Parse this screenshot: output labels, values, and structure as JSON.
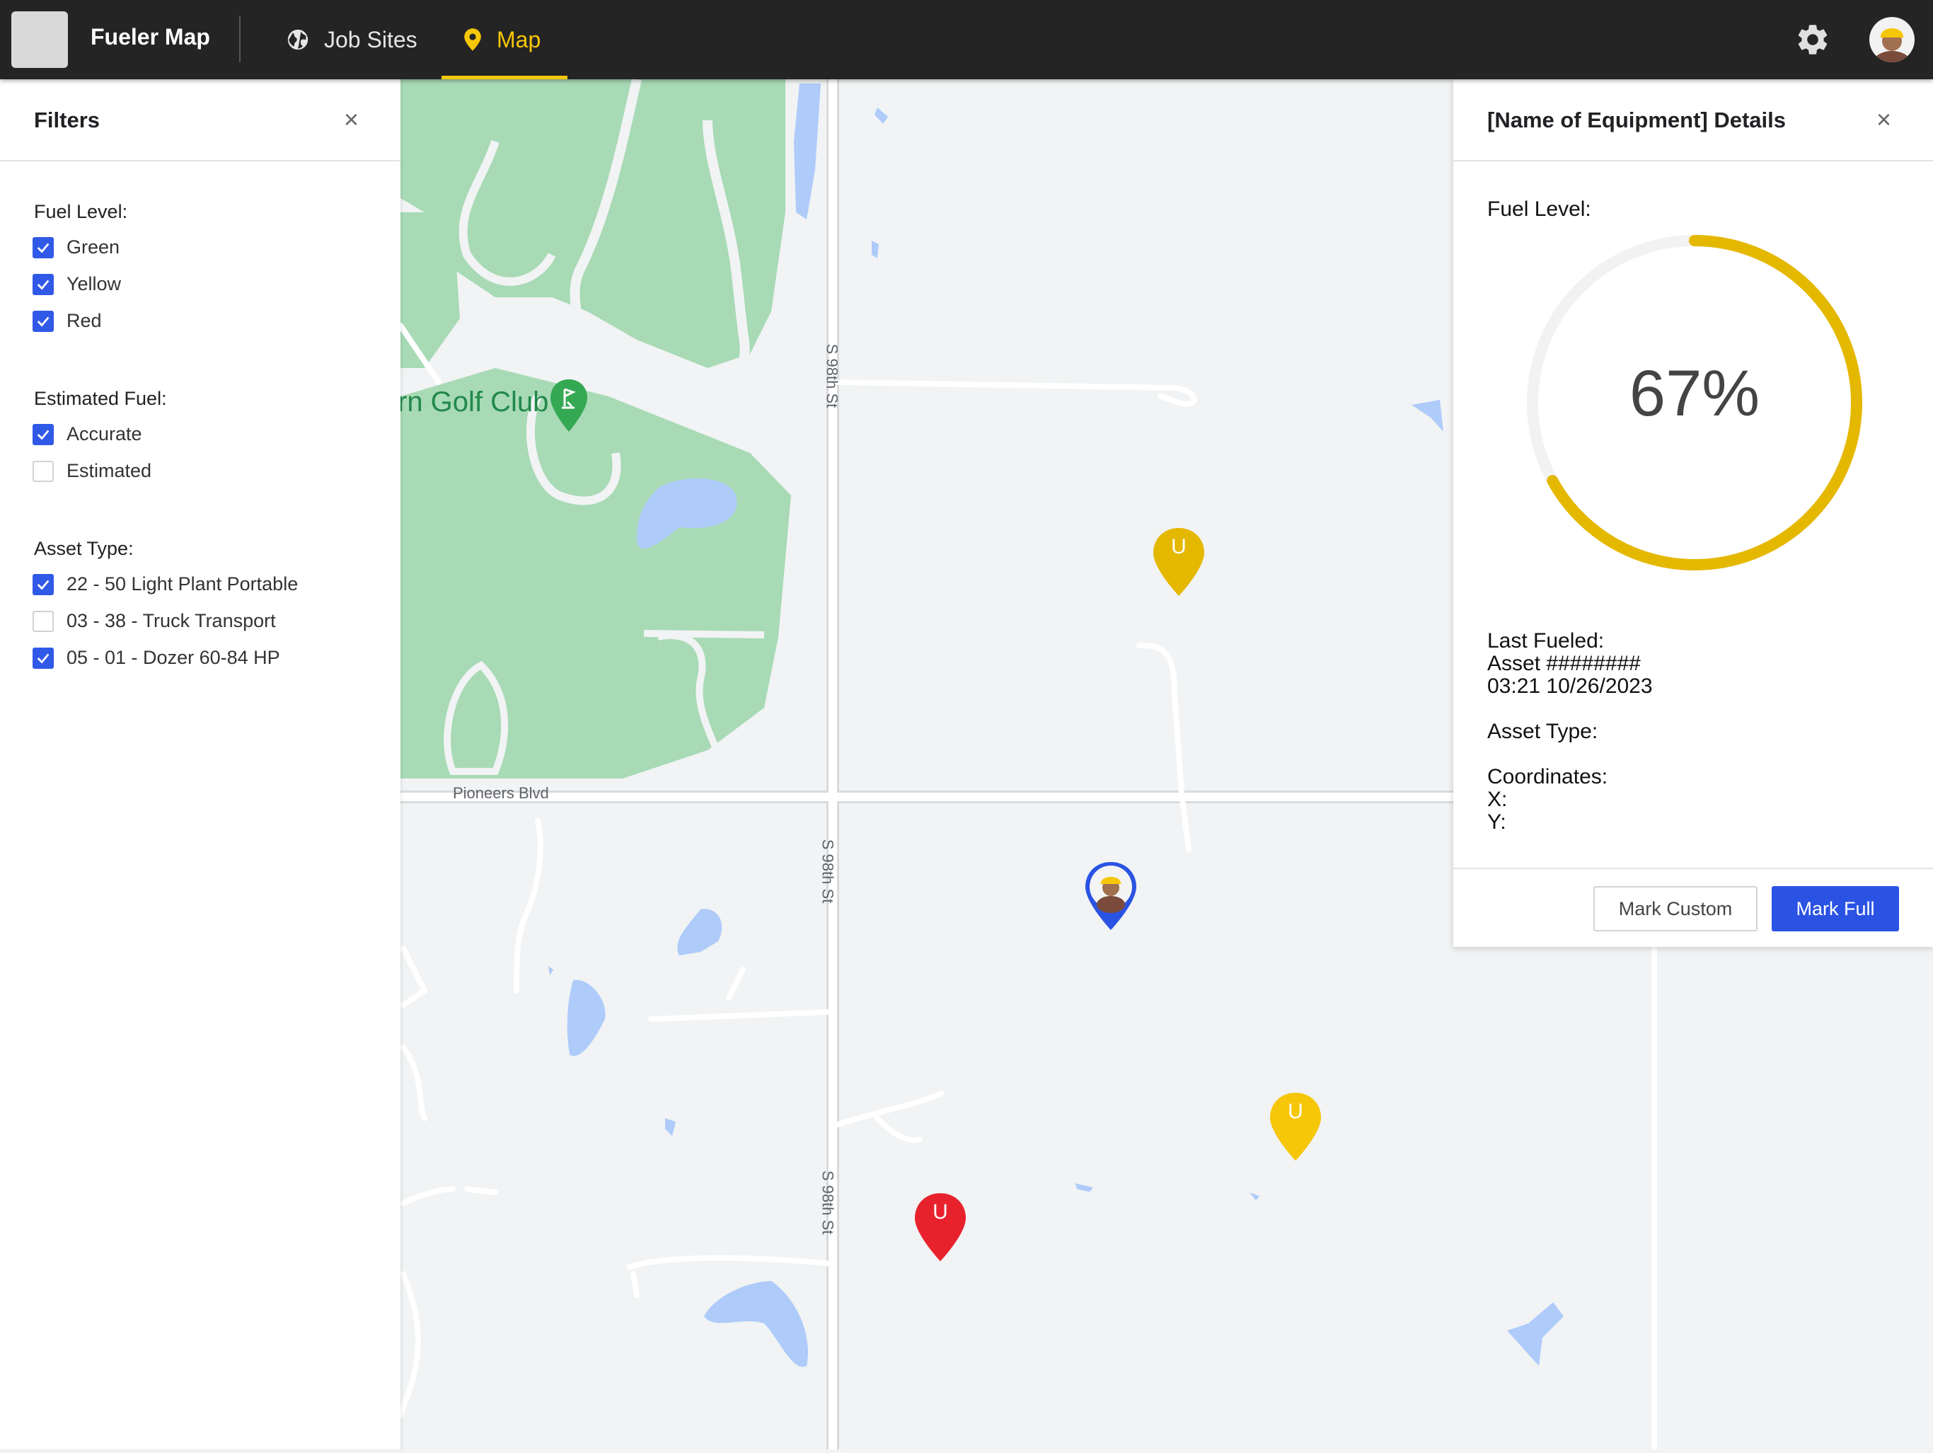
{
  "header": {
    "app_title": "Fueler Map",
    "nav": [
      {
        "label": "Job Sites",
        "icon": "globe-icon",
        "active": false
      },
      {
        "label": "Map",
        "icon": "map-pin-icon",
        "active": true
      }
    ],
    "settings_icon": "gear-icon",
    "avatar": "user-avatar"
  },
  "map": {
    "labels": {
      "golf_club": "rn Golf Club",
      "road_1": "S 98th St",
      "road_2": "S 98th St",
      "road_3": "S 98th St",
      "pioneers": "Pioneers Blvd"
    },
    "markers": [
      {
        "label": "U",
        "status": "yellow",
        "color": "#e5b800"
      },
      {
        "label": "",
        "status": "user",
        "color": "#2b53e3"
      },
      {
        "label": "U",
        "status": "yellow",
        "color": "#f6c609"
      },
      {
        "label": "U",
        "status": "red",
        "color": "#e8222d"
      }
    ]
  },
  "filters": {
    "title": "Filters",
    "groups": [
      {
        "label": "Fuel Level:",
        "options": [
          {
            "label": "Green",
            "checked": true
          },
          {
            "label": "Yellow",
            "checked": true
          },
          {
            "label": "Red",
            "checked": true
          }
        ]
      },
      {
        "label": "Estimated Fuel:",
        "options": [
          {
            "label": "Accurate",
            "checked": true
          },
          {
            "label": "Estimated",
            "checked": false
          }
        ]
      },
      {
        "label": "Asset Type:",
        "options": [
          {
            "label": "22 - 50 Light Plant Portable",
            "checked": true
          },
          {
            "label": "03 - 38 - Truck Transport",
            "checked": false
          },
          {
            "label": "05 - 01 - Dozer 60-84 HP",
            "checked": true
          }
        ]
      }
    ]
  },
  "details": {
    "title": "[Name of Equipment] Details",
    "fuel_level_label": "Fuel Level:",
    "fuel_percent": 67,
    "fuel_percent_text": "67%",
    "gauge_color": "#e5b800",
    "gauge_track_color": "#f2f2f2",
    "last_fueled_label": "Last Fueled:",
    "last_fueled_asset": "Asset ########",
    "last_fueled_time": "03:21 10/26/2023",
    "asset_type_label": "Asset Type:",
    "coordinates_label": "Coordinates:",
    "x_label": "X:",
    "y_label": "Y:",
    "mark_custom": "Mark Custom",
    "mark_full": "Mark Full"
  }
}
